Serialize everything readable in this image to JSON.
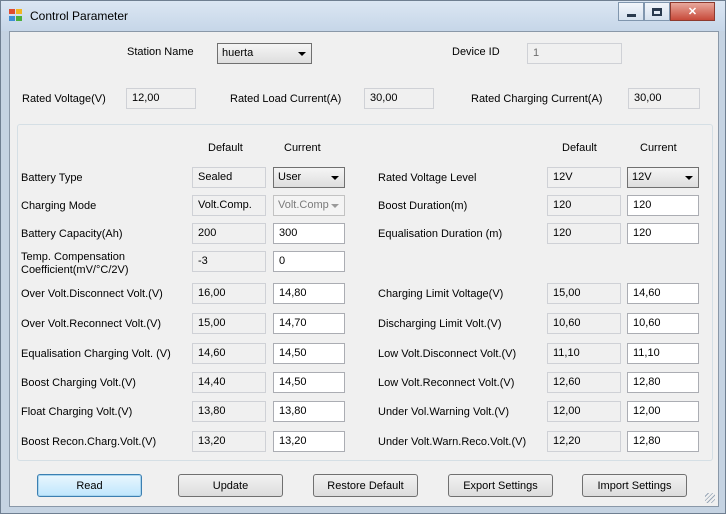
{
  "window": {
    "title": "Control Parameter",
    "controls": {
      "minimize": "minimize",
      "maximize": "maximize",
      "close": "close"
    }
  },
  "header": {
    "station_name_label": "Station Name",
    "station_name_value": "huerta",
    "device_id_label": "Device ID",
    "device_id_value": "1",
    "rated_voltage_label": "Rated Voltage(V)",
    "rated_voltage_value": "12,00",
    "rated_load_current_label": "Rated Load Current(A)",
    "rated_load_current_value": "30,00",
    "rated_charging_current_label": "Rated Charging Current(A)",
    "rated_charging_current_value": "30,00"
  },
  "columns": {
    "left_default": "Default",
    "left_current": "Current",
    "right_default": "Default",
    "right_current": "Current"
  },
  "left_params": [
    {
      "label": "Battery Type",
      "default": "Sealed",
      "current": "User",
      "current_kind": "combo"
    },
    {
      "label": "Charging Mode",
      "default": "Volt.Comp.",
      "current": "Volt.Comp",
      "current_kind": "combo-disabled"
    },
    {
      "label": "Battery Capacity(Ah)",
      "default": "200",
      "current": "300",
      "current_kind": "text"
    },
    {
      "label": "Temp. Compensation Coefficient(mV/°C/2V)",
      "default": "-3",
      "current": "0",
      "current_kind": "text"
    },
    {
      "label": "Over Volt.Disconnect Volt.(V)",
      "default": "16,00",
      "current": "14,80",
      "current_kind": "text"
    },
    {
      "label": "Over Volt.Reconnect Volt.(V)",
      "default": "15,00",
      "current": "14,70",
      "current_kind": "text"
    },
    {
      "label": "Equalisation Charging Volt. (V)",
      "default": "14,60",
      "current": "14,50",
      "current_kind": "text"
    },
    {
      "label": "Boost Charging Volt.(V)",
      "default": "14,40",
      "current": "14,50",
      "current_kind": "text"
    },
    {
      "label": "Float Charging Volt.(V)",
      "default": "13,80",
      "current": "13,80",
      "current_kind": "text"
    },
    {
      "label": "Boost Recon.Charg.Volt.(V)",
      "default": "13,20",
      "current": "13,20",
      "current_kind": "text"
    }
  ],
  "right_params": [
    {
      "label": "Rated Voltage Level",
      "default": "12V",
      "current": "12V",
      "current_kind": "combo"
    },
    {
      "label": "Boost Duration(m)",
      "default": "120",
      "current": "120",
      "current_kind": "text"
    },
    {
      "label": "Equalisation Duration (m)",
      "default": "120",
      "current": "120",
      "current_kind": "text"
    },
    {
      "label": "Charging Limit Voltage(V)",
      "default": "15,00",
      "current": "14,60",
      "current_kind": "text"
    },
    {
      "label": "Discharging Limit Volt.(V)",
      "default": "10,60",
      "current": "10,60",
      "current_kind": "text"
    },
    {
      "label": "Low Volt.Disconnect Volt.(V)",
      "default": "11,10",
      "current": "11,10",
      "current_kind": "text"
    },
    {
      "label": "Low Volt.Reconnect Volt.(V)",
      "default": "12,60",
      "current": "12,80",
      "current_kind": "text"
    },
    {
      "label": "Under Vol.Warning Volt.(V)",
      "default": "12,00",
      "current": "12,00",
      "current_kind": "text"
    },
    {
      "label": "Under Volt.Warn.Reco.Volt.(V)",
      "default": "12,20",
      "current": "12,80",
      "current_kind": "text"
    }
  ],
  "buttons": {
    "read": "Read",
    "update": "Update",
    "restore_default": "Restore Default",
    "export_settings": "Export Settings",
    "import_settings": "Import Settings"
  },
  "colors": {
    "title_bar": "#c6d6e8",
    "client_bg": "#f0f0f0",
    "close_button": "#c74a3a",
    "focused_button": "#3c7fb1"
  }
}
